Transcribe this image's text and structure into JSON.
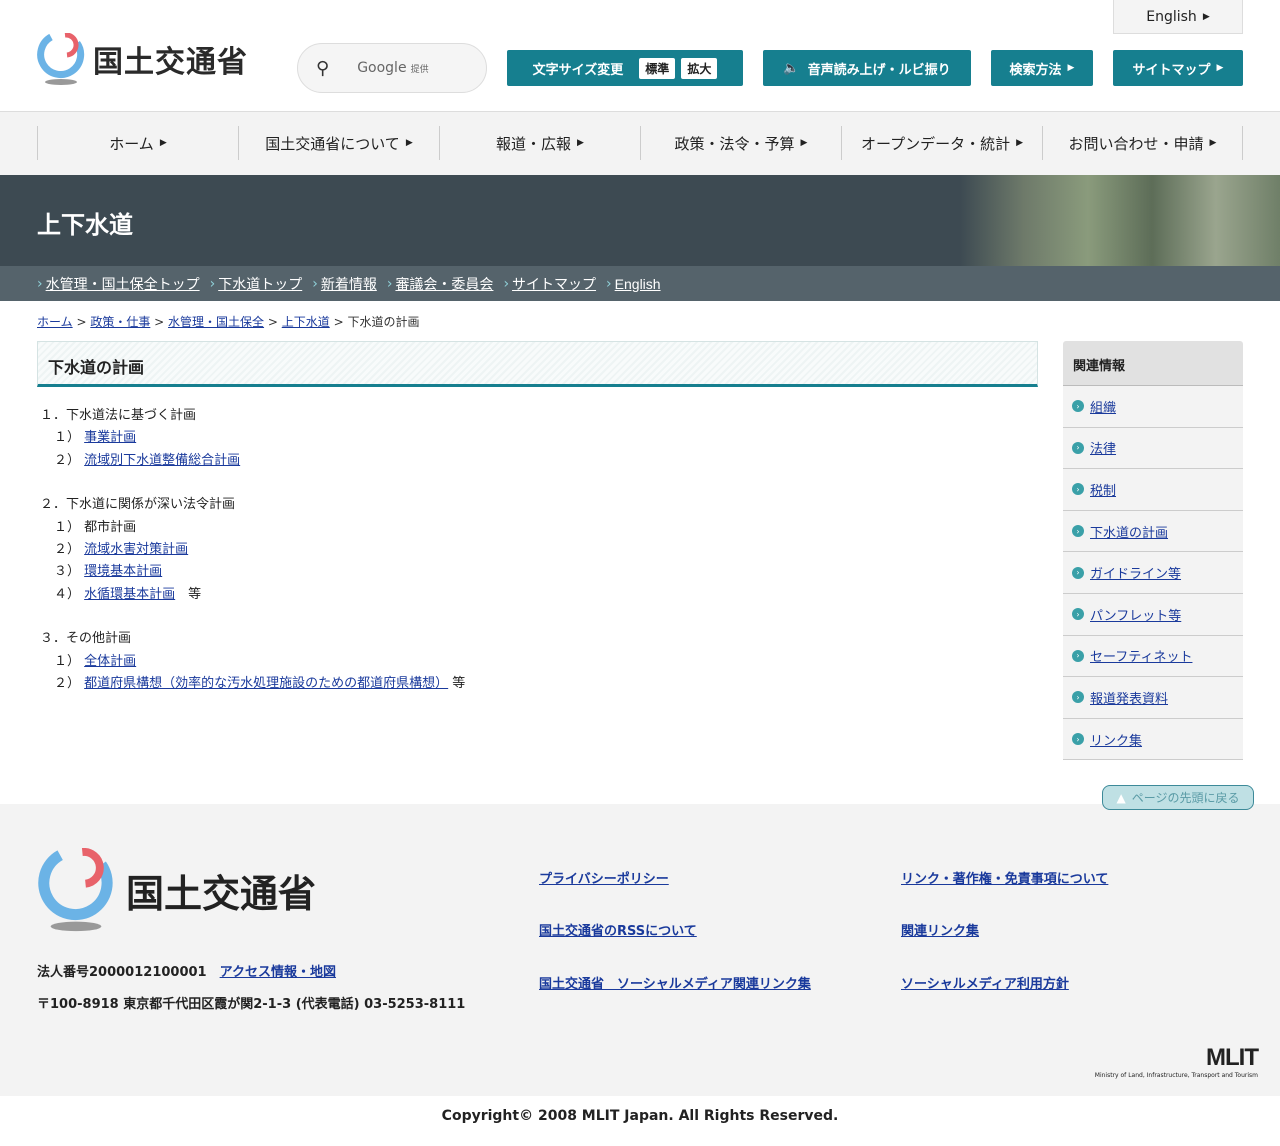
{
  "header": {
    "logo_text": "国土交通省",
    "search": {
      "brand": "Google",
      "suffix": "提供"
    },
    "font_size_label": "文字サイズ変更",
    "font_standard": "標準",
    "font_large": "拡大",
    "speech_label": "音声読み上げ・ルビ振り",
    "search_method": "検索方法",
    "sitemap": "サイトマップ",
    "english": "English"
  },
  "nav": [
    "ホーム",
    "国土交通省について",
    "報道・広報",
    "政策・法令・予算",
    "オープンデータ・統計",
    "お問い合わせ・申請"
  ],
  "banner": {
    "title": "上下水道"
  },
  "subnav": [
    "水管理・国土保全トップ",
    "下水道トップ",
    "新着情報",
    "審議会・委員会",
    "サイトマップ",
    "English"
  ],
  "breadcrumb": {
    "links": [
      "ホーム",
      "政策・仕事",
      "水管理・国土保全",
      "上下水道"
    ],
    "current": "下水道の計画"
  },
  "main": {
    "title": "下水道の計画",
    "sections": [
      {
        "heading": "１．下水道法に基づく計画",
        "items": [
          {
            "num": "１）",
            "text": "事業計画",
            "link": true
          },
          {
            "num": "２）",
            "text": "流域別下水道整備総合計画",
            "link": true
          }
        ]
      },
      {
        "heading": "２．下水道に関係が深い法令計画",
        "items": [
          {
            "num": "１）",
            "text": "都市計画",
            "link": false
          },
          {
            "num": "２）",
            "text": "流域水害対策計画",
            "link": true
          },
          {
            "num": "３）",
            "text": "環境基本計画",
            "link": true
          },
          {
            "num": "４）",
            "text": "水循環基本計画",
            "link": true,
            "suffix": "　等"
          }
        ]
      },
      {
        "heading": "３．その他計画",
        "items": [
          {
            "num": "１）",
            "text": "全体計画",
            "link": true
          },
          {
            "num": "２）",
            "text": "都道府県構想（効率的な汚水処理施設のための都道府県構想）",
            "link": true,
            "suffix": " 等"
          }
        ]
      }
    ]
  },
  "sidebar": {
    "title": "関連情報",
    "items": [
      "組織",
      "法律",
      "税制",
      "下水道の計画",
      "ガイドライン等",
      "パンフレット等",
      "セーフティネット",
      "報道発表資料",
      "リンク集"
    ]
  },
  "to_top": "ページの先頭に戻る",
  "footer": {
    "logo_text": "国土交通省",
    "corp_number": "法人番号2000012100001",
    "access": "アクセス情報・地図",
    "address": "〒100-8918 東京都千代田区霞が関2-1-3 (代表電話) 03-5253-8111",
    "links": [
      "プライバシーポリシー",
      "リンク・著作権・免責事項について",
      "国土交通省のRSSについて",
      "関連リンク集",
      "国土交通省　ソーシャルメディア関連リンク集",
      "ソーシャルメディア利用方針"
    ],
    "mlit": "MLIT",
    "mlit_sub": "Ministry of Land, Infrastructure, Transport and Tourism",
    "copyright": "Copyright© 2008 MLIT Japan. All Rights Reserved."
  },
  "colors": {
    "teal": "#167f8f",
    "banner": "#3d4a52",
    "subnav": "#55636b"
  }
}
